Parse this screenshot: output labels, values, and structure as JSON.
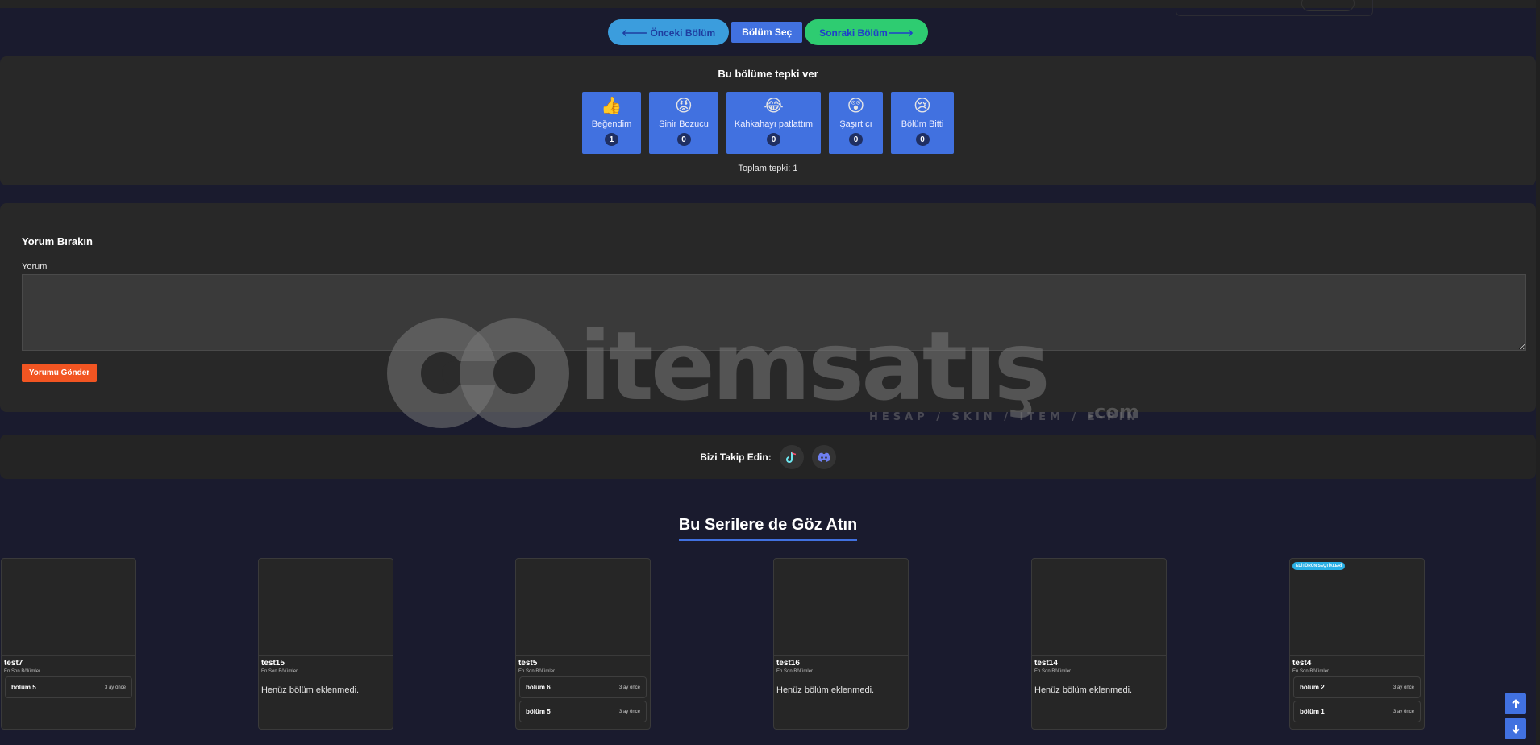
{
  "nav": {
    "prev_label": "🡐 Önceki Bölüm",
    "select_label": "Bölüm Seç",
    "next_label": "Sonraki Bölüm🡒"
  },
  "reactions": {
    "title": "Bu bölüme tepki ver",
    "items": [
      {
        "emoji": "👍",
        "label": "Beğendim",
        "count": "1"
      },
      {
        "emoji": "😡",
        "label": "Sinir Bozucu",
        "count": "0"
      },
      {
        "emoji": "😂",
        "label": "Kahkahayı patlattım",
        "count": "0"
      },
      {
        "emoji": "😲",
        "label": "Şaşırtıcı",
        "count": "0"
      },
      {
        "emoji": "😢",
        "label": "Bölüm Bitti",
        "count": "0"
      }
    ],
    "total": "Toplam tepki: 1"
  },
  "comment": {
    "title": "Yorum Bırakın",
    "field_label": "Yorum",
    "value": "",
    "submit_label": "Yorumu Gönder"
  },
  "watermark": {
    "brand": "itemsatış",
    "tagline": "HESAP / SKIN / ITEM / E-PIN",
    "domain": ".com"
  },
  "follow": {
    "label": "Bizi Takip Edin:",
    "icons": [
      "tiktok-icon",
      "discord-icon"
    ]
  },
  "series": {
    "title": "Bu Serilere de Göz Atın",
    "cards": [
      {
        "name": "test7",
        "sub": "En Son Bölümler",
        "episodes": [
          {
            "name": "bölüm 5",
            "time": "3 ay önce"
          }
        ]
      },
      {
        "name": "test15",
        "sub": "En Son Bölümler",
        "empty": "Henüz bölüm eklenmedi.",
        "episodes": []
      },
      {
        "name": "test5",
        "sub": "En Son Bölümler",
        "episodes": [
          {
            "name": "bölüm 6",
            "time": "3 ay önce"
          },
          {
            "name": "bölüm 5",
            "time": "3 ay önce"
          }
        ]
      },
      {
        "name": "test16",
        "sub": "En Son Bölümler",
        "empty": "Henüz bölüm eklenmedi.",
        "episodes": []
      },
      {
        "name": "test14",
        "sub": "En Son Bölümler",
        "empty": "Henüz bölüm eklenmedi.",
        "episodes": []
      },
      {
        "name": "test4",
        "sub": "En Son Bölümler",
        "badge": "EDİTÖRÜN SEÇTİKLERİ",
        "episodes": [
          {
            "name": "bölüm 2",
            "time": "3 ay önce"
          },
          {
            "name": "bölüm 1",
            "time": "3 ay önce"
          }
        ]
      }
    ]
  },
  "colors": {
    "background": "#1a1b2e",
    "panel": "#282828",
    "accent_blue": "#4171e0",
    "prev_button": "#3b9ddd",
    "next_button": "#2ecc71",
    "submit_button": "#f25522",
    "badge": "#2bb0e5"
  }
}
